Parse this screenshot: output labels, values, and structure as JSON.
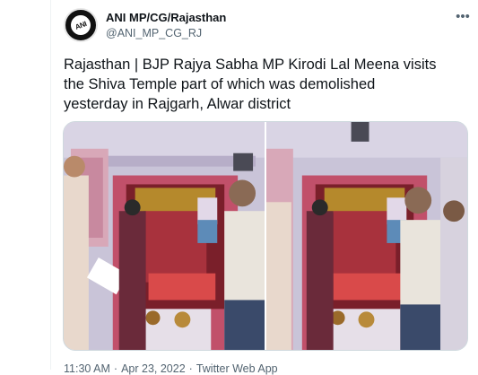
{
  "account": {
    "display_name": "ANI MP/CG/Rajasthan",
    "handle": "@ANI_MP_CG_RJ",
    "avatar_text": "ANI"
  },
  "tweet": {
    "text": "Rajasthan | BJP Rajya Sabha MP Kirodi Lal Meena visits\nthe Shiva Temple part of which was demolished\nyesterday in Rajgarh, Alwar district"
  },
  "meta": {
    "time": "11:30 AM",
    "separator": "·",
    "date": "Apr 23, 2022",
    "source": "Twitter Web App"
  },
  "icons": {
    "more": "more-horizontal-icon"
  },
  "colors": {
    "text": "#0f1419",
    "secondary": "#536471",
    "border": "#cfd9de"
  }
}
